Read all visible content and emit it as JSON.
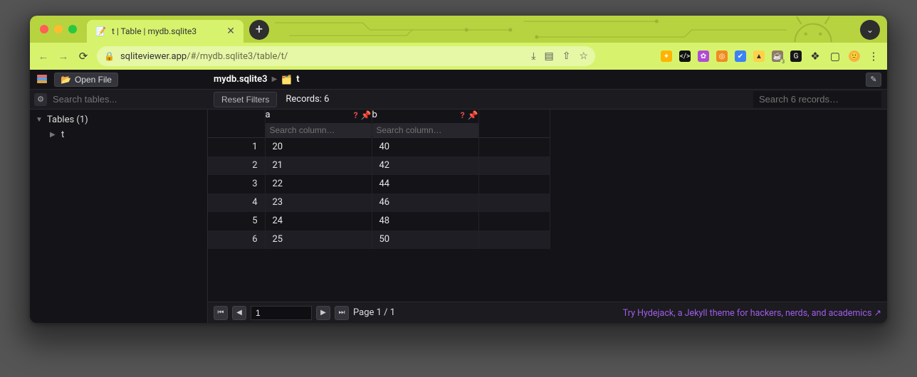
{
  "browser": {
    "tab_title": "t | Table | mydb.sqlite3",
    "url_host": "sqliteviewer.app",
    "url_path": "/#/mydb.sqlite3/table/t/"
  },
  "toolbar": {
    "open_file_label": "Open File",
    "breadcrumb_db": "mydb.sqlite3",
    "breadcrumb_table": "t"
  },
  "sidebar": {
    "search_placeholder": "Search tables...",
    "group_label": "Tables (1)",
    "items": [
      {
        "label": "t"
      }
    ]
  },
  "filters": {
    "reset_label": "Reset Filters",
    "records_label": "Records: 6",
    "search_records_placeholder": "Search 6 records…",
    "column_search_placeholder": "Search column…"
  },
  "table": {
    "columns": [
      "a",
      "b"
    ],
    "rows": [
      {
        "n": 1,
        "a": "20",
        "b": "40"
      },
      {
        "n": 2,
        "a": "21",
        "b": "42"
      },
      {
        "n": 3,
        "a": "22",
        "b": "44"
      },
      {
        "n": 4,
        "a": "23",
        "b": "46"
      },
      {
        "n": 5,
        "a": "24",
        "b": "48"
      },
      {
        "n": 6,
        "a": "25",
        "b": "50"
      }
    ]
  },
  "pager": {
    "current_page": "1",
    "page_label": "Page 1 / 1"
  },
  "promo": {
    "text": "Try Hydejack, a Jekyll theme for hackers, nerds, and academics ↗"
  }
}
